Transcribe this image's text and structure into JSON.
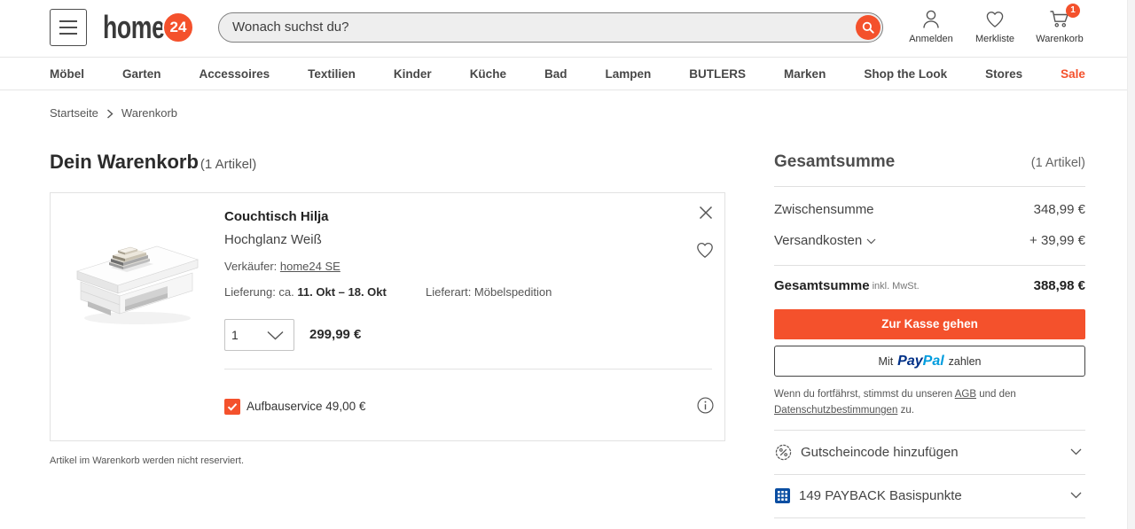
{
  "header": {
    "menu_icon": "hamburger-menu-icon",
    "logo": {
      "text": "home",
      "badge": "24"
    },
    "search": {
      "placeholder": "Wonach suchst du?",
      "icon": "search-icon"
    },
    "actions": [
      {
        "label": "Anmelden",
        "icon": "user-icon"
      },
      {
        "label": "Merkliste",
        "icon": "heart-icon"
      },
      {
        "label": "Warenkorb",
        "icon": "cart-icon",
        "badge": "1"
      }
    ]
  },
  "nav": {
    "items": [
      "Möbel",
      "Garten",
      "Accessoires",
      "Textilien",
      "Kinder",
      "Küche",
      "Bad",
      "Lampen",
      "BUTLERS",
      "Marken",
      "Shop the Look",
      "Stores",
      "Sale"
    ]
  },
  "breadcrumb": {
    "items": [
      "Startseite",
      "Warenkorb"
    ],
    "separator_icon": "chevron-right-icon"
  },
  "cart": {
    "title": "Dein Warenkorb",
    "count": "(1 Artikel)",
    "item": {
      "name": "Couchtisch Hilja",
      "variant": "Hochglanz Weiß",
      "seller_label": "Verkäufer:",
      "seller": "home24 SE",
      "delivery_label": "Lieferung: ca.",
      "delivery_dates": "11. Okt – 18. Okt",
      "shipping_type": "Lieferart: Möbelspedition",
      "quantity": "1",
      "price": "299,99 €",
      "service": {
        "label": "Aufbauservice 49,00 €",
        "checked": true
      },
      "icons": {
        "remove": "close-icon",
        "wishlist": "heart-icon",
        "info": "info-icon",
        "quantity": "chevron-down-icon"
      }
    },
    "notice": "Artikel im Warenkorb werden nicht reserviert."
  },
  "summary": {
    "title": "Gesamtsumme",
    "count": "(1 Artikel)",
    "subtotal_label": "Zwischensumme",
    "subtotal": "348,99 €",
    "shipping_label": "Versandkosten",
    "shipping": "+ 39,99 €",
    "total_label": "Gesamtsumme",
    "total_note": "inkl. MwSt.",
    "total": "388,98 €",
    "checkout_label": "Zur Kasse gehen",
    "paypal": {
      "prefix": "Mit",
      "brand_pay": "Pay",
      "brand_pal": "Pal",
      "suffix": "zahlen"
    },
    "legal": {
      "before": "Wenn du fortfährst, stimmst du unseren",
      "agb": "AGB",
      "middle": "und den",
      "privacy": "Datenschutzbestimmungen",
      "after": "zu."
    },
    "voucher": {
      "label": "Gutscheincode hinzufügen",
      "icon": "percent-badge-icon"
    },
    "payback": {
      "label": "149 PAYBACK Basispunkte",
      "icon": "payback-icon"
    }
  },
  "colors": {
    "accent": "#f4512c",
    "text": "#2d2d2d",
    "paypal_dark": "#003087",
    "paypal_light": "#009cde",
    "payback": "#0a4ea2"
  }
}
